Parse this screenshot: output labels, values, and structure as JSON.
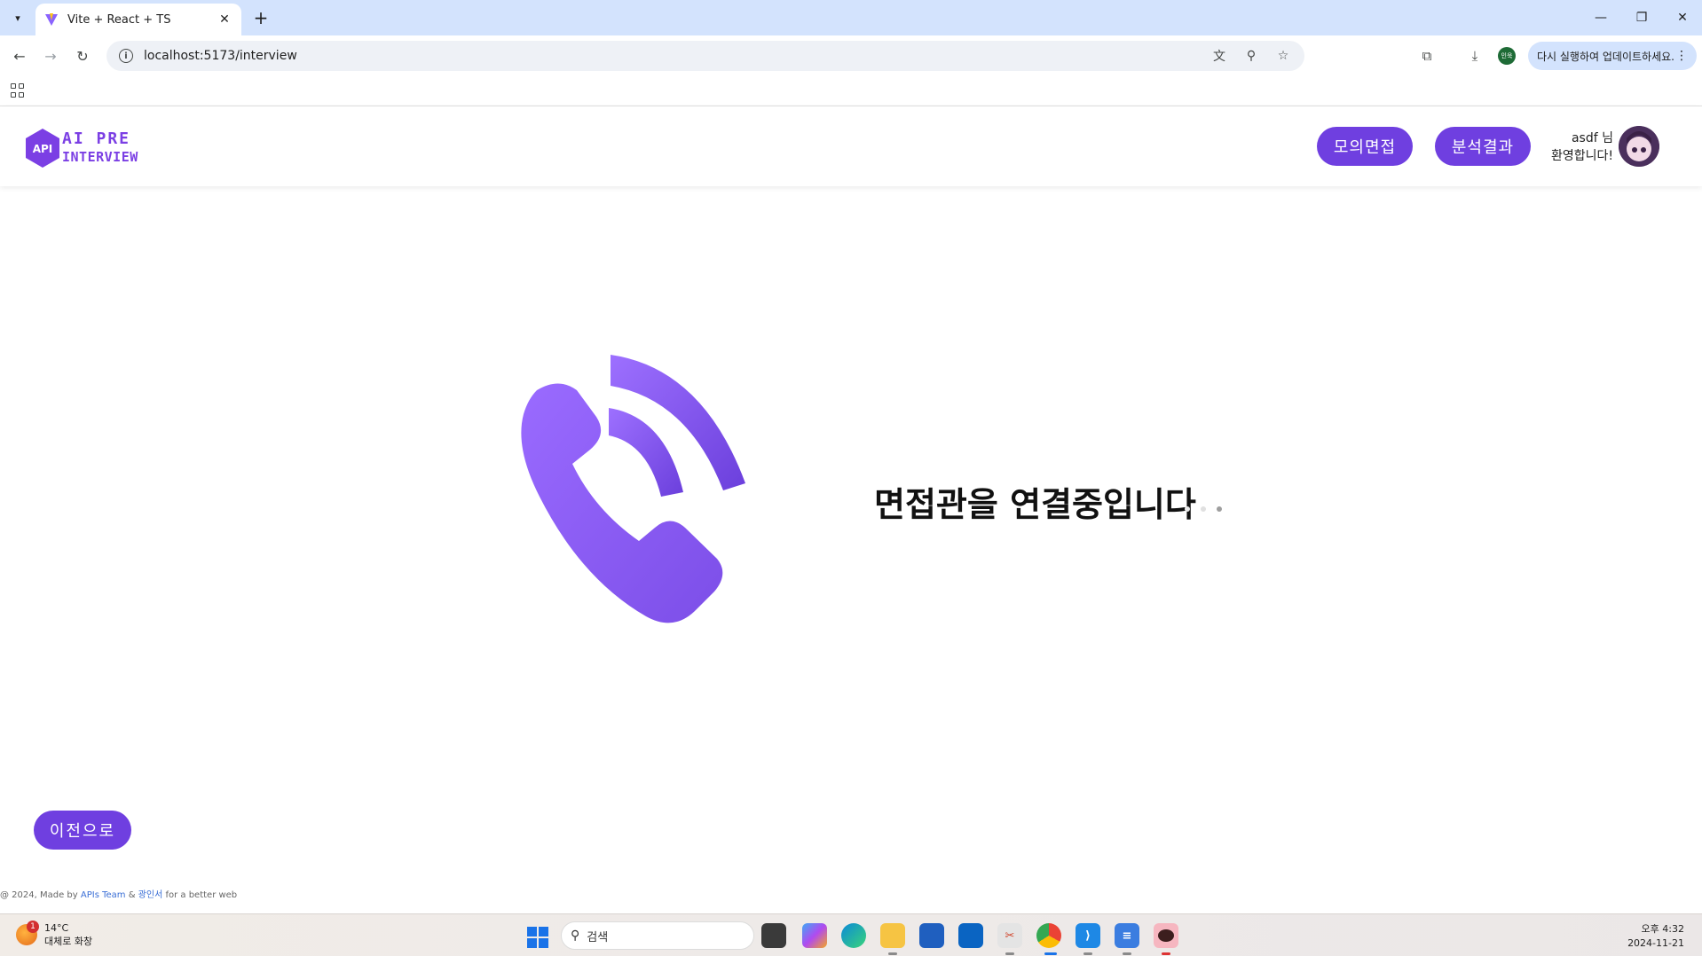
{
  "browser": {
    "tab_title": "Vite + React + TS",
    "url": "localhost:5173/interview",
    "profile_label": "인욱",
    "update_label": "다시 실행하여 업데이트하세요."
  },
  "header": {
    "logo_badge": "API",
    "logo_line1": "AI PRE",
    "logo_line2": "INTERVIEW",
    "nav_mock_interview": "모의면접",
    "nav_analysis": "분석결과",
    "welcome_name": "asdf 님",
    "welcome_text": "환영합니다!"
  },
  "main": {
    "status_text": "면접관을 연결중입니다",
    "back_button": "이전으로"
  },
  "footer": {
    "prefix": "@ 2024, Made by ",
    "team": "APIs Team",
    "and": " & ",
    "author": "광인서",
    "suffix": " for a better web"
  },
  "taskbar": {
    "weather_temp": "14°C",
    "weather_desc": "대체로 화창",
    "weather_badge": "1",
    "search_placeholder": "검색",
    "time": "오후 4:32",
    "date": "2024-11-21"
  },
  "colors": {
    "primary": "#6f3fe0",
    "phone": "#8a5cf0",
    "dot_light": "#e6e6e6",
    "dot_dark": "#999999"
  }
}
